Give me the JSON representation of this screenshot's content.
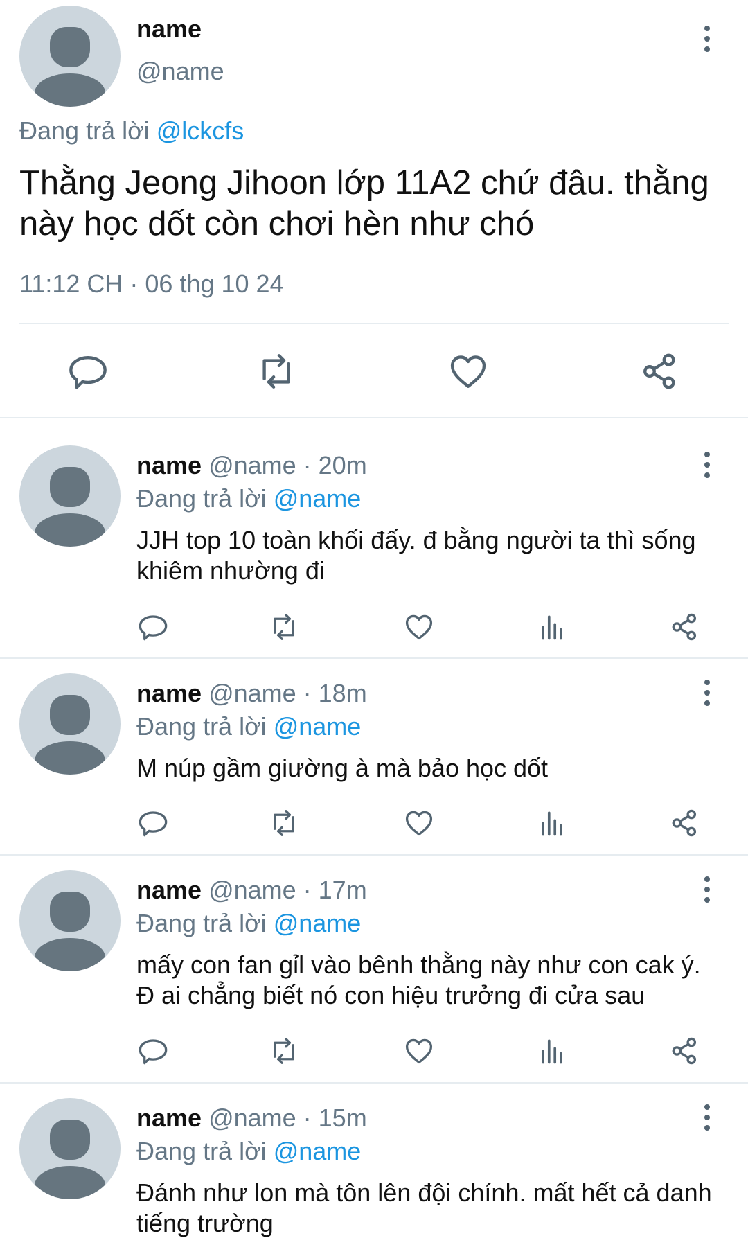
{
  "main_tweet": {
    "name": "name",
    "handle": "@name",
    "reply_prefix": "Đang trả lời ",
    "reply_to": "@lckcfs",
    "text": "Thằng Jeong Jihoon lớp 11A2 chứ đâu. thằng này học dốt còn chơi hèn như chó",
    "timestamp": "11:12 CH · 06 thg 10 24"
  },
  "replies": [
    {
      "name": "name",
      "meta": "@name · 20m",
      "reply_prefix": "Đang trả lời ",
      "reply_to": "@name",
      "text": "JJH top 10 toàn khối đấy. đ bằng người ta thì sống khiêm nhường đi"
    },
    {
      "name": "name",
      "meta": "@name · 18m",
      "reply_prefix": "Đang trả lời ",
      "reply_to": "@name",
      "text": "M núp gầm giường à mà bảo học dốt"
    },
    {
      "name": "name",
      "meta": "@name · 17m",
      "reply_prefix": "Đang trả lời ",
      "reply_to": "@name",
      "text": "mấy con fan gỉl vào bênh thằng này như con cak ý. Đ ai chẳng biết nó con hiệu trưởng đi cửa sau"
    },
    {
      "name": "name",
      "meta": "@name · 15m",
      "reply_prefix": "Đang trả lời ",
      "reply_to": "@name",
      "text": "Đánh như lon mà tôn lên đội chính. mất hết cả danh tiếng trường"
    }
  ],
  "icons": {
    "reply": "reply-icon",
    "retweet": "retweet-icon",
    "like": "heart-icon",
    "analytics": "analytics-icon",
    "share": "share-icon",
    "more": "more-icon"
  },
  "colors": {
    "accent": "#1b95e0",
    "secondary_text": "#657786",
    "icon_gray": "#536471",
    "avatar_bg": "#ccd6dd",
    "avatar_fg": "#66757f"
  }
}
